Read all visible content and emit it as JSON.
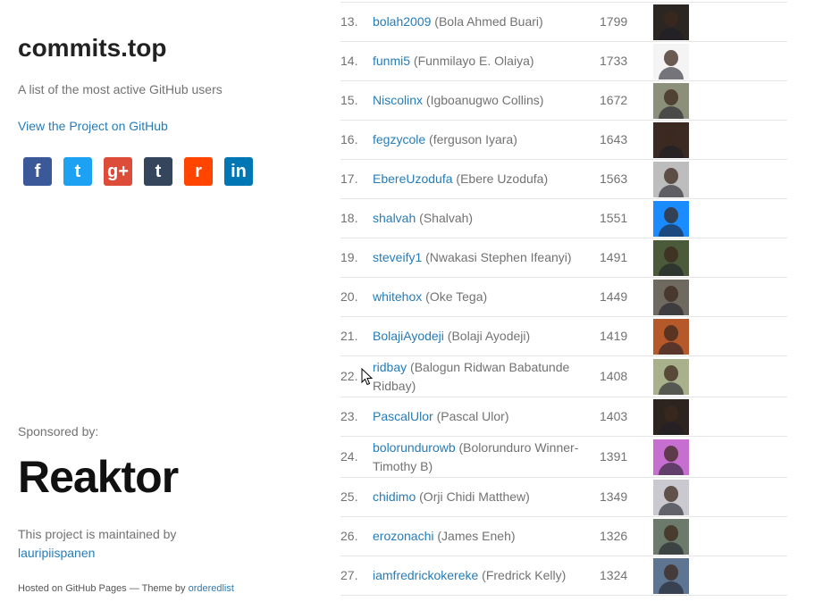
{
  "sidebar": {
    "title": "commits.top",
    "description": "A list of the most active GitHub users",
    "project_link": "View the Project on GitHub",
    "share": [
      {
        "icon": "facebook-icon",
        "glyph": "f",
        "color": "#3B5998"
      },
      {
        "icon": "twitter-icon",
        "glyph": "t",
        "color": "#1DA1F2"
      },
      {
        "icon": "google-plus-icon",
        "glyph": "g+",
        "color": "#DD4B39"
      },
      {
        "icon": "tumblr-icon",
        "glyph": "t",
        "color": "#35465C"
      },
      {
        "icon": "reddit-icon",
        "glyph": "r",
        "color": "#FF4500"
      },
      {
        "icon": "linkedin-icon",
        "glyph": "in",
        "color": "#0077B5"
      }
    ],
    "sponsored_label": "Sponsored by:",
    "sponsor_name": "Reaktor",
    "maintained_prefix": "This project is maintained by",
    "maintainer": "lauripiispanen",
    "hosted_prefix": "Hosted on GitHub Pages — Theme by",
    "theme_author": "orderedlist"
  },
  "users": [
    {
      "rank": "13.",
      "login": "bolah2009",
      "name": "(Bola Ahmed Buari)",
      "commits": "1799",
      "avatar_color": "#2b2622"
    },
    {
      "rank": "14.",
      "login": "funmi5",
      "name": "(Funmilayo E. Olaiya)",
      "commits": "1733",
      "avatar_color": "#f4f4f4"
    },
    {
      "rank": "15.",
      "login": "Niscolinx",
      "name": "(Igboanugwo Collins)",
      "commits": "1672",
      "avatar_color": "#8c8f7a"
    },
    {
      "rank": "16.",
      "login": "fegzycole",
      "name": "(ferguson Iyara)",
      "commits": "1643",
      "avatar_color": "#3a2a22"
    },
    {
      "rank": "17.",
      "login": "EbereUzodufa",
      "name": "(Ebere Uzodufa)",
      "commits": "1563",
      "avatar_color": "#bdbdbd"
    },
    {
      "rank": "18.",
      "login": "shalvah",
      "name": "(Shalvah)",
      "commits": "1551",
      "avatar_color": "#1a8cff"
    },
    {
      "rank": "19.",
      "login": "steveify1",
      "name": "(Nwakasi Stephen Ifeanyi)",
      "commits": "1491",
      "avatar_color": "#4a5a3a"
    },
    {
      "rank": "20.",
      "login": "whitehox",
      "name": "(Oke Tega)",
      "commits": "1449",
      "avatar_color": "#6f6a60"
    },
    {
      "rank": "21.",
      "login": "BolajiAyodeji",
      "name": "(Bolaji Ayodeji)",
      "commits": "1419",
      "avatar_color": "#b5592b"
    },
    {
      "rank": "22.",
      "login": "ridbay",
      "name": "(Balogun Ridwan Babatunde Ridbay)",
      "commits": "1408",
      "avatar_color": "#a9b08c"
    },
    {
      "rank": "23.",
      "login": "PascalUlor",
      "name": "(Pascal Ulor)",
      "commits": "1403",
      "avatar_color": "#2d241f"
    },
    {
      "rank": "24.",
      "login": "bolorundurowb",
      "name": "(Bolorunduro Winner-Timothy B)",
      "commits": "1391",
      "avatar_color": "#c76fd0"
    },
    {
      "rank": "25.",
      "login": "chidimo",
      "name": "(Orji Chidi Matthew)",
      "commits": "1349",
      "avatar_color": "#c9c9cf"
    },
    {
      "rank": "26.",
      "login": "erozonachi",
      "name": "(James Eneh)",
      "commits": "1326",
      "avatar_color": "#6b7a6a"
    },
    {
      "rank": "27.",
      "login": "iamfredrickokereke",
      "name": "(Fredrick Kelly)",
      "commits": "1324",
      "avatar_color": "#5d7590"
    }
  ]
}
